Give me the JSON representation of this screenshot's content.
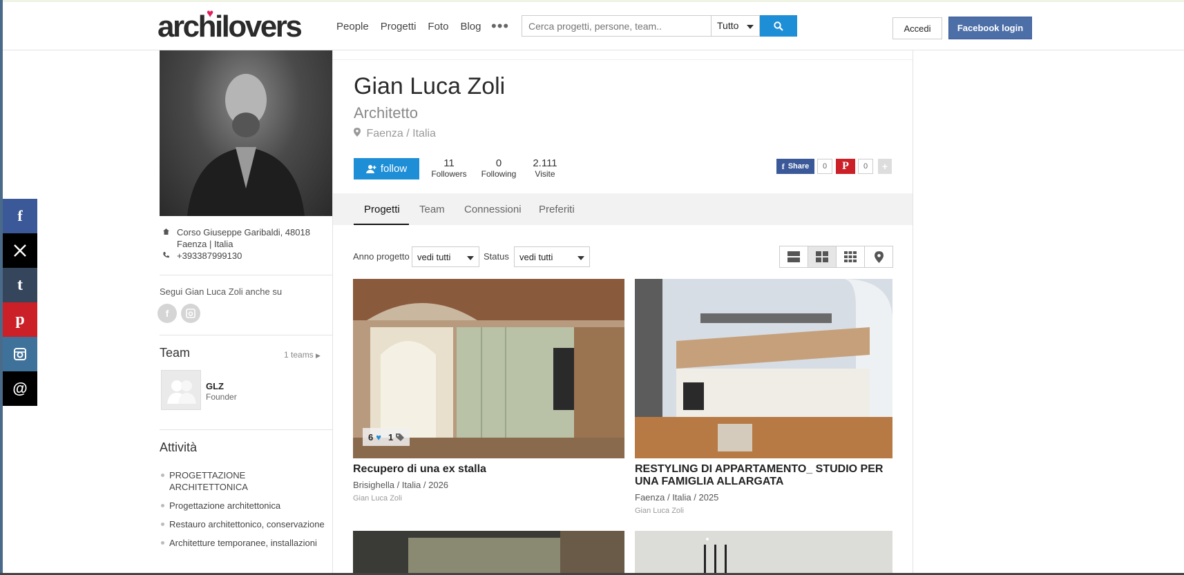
{
  "header": {
    "logo": "archilovers",
    "nav": [
      "People",
      "Progetti",
      "Foto",
      "Blog"
    ],
    "search_placeholder": "Cerca progetti, persone, team..",
    "search_scope": "Tutto",
    "login_label": "Accedi",
    "facebook_login_label": "Facebook login"
  },
  "social_share": [
    {
      "icon": "facebook-icon",
      "color": "#3b5998"
    },
    {
      "icon": "x-icon",
      "color": "#000000"
    },
    {
      "icon": "tumblr-icon",
      "color": "#35465c"
    },
    {
      "icon": "pinterest-icon",
      "color": "#cb2027"
    },
    {
      "icon": "instagram-icon",
      "color": "#3f729b"
    },
    {
      "icon": "threads-icon",
      "color": "#000000"
    }
  ],
  "profile": {
    "name": "Gian Luca Zoli",
    "profession": "Architetto",
    "location": "Faenza / Italia",
    "follow_label": "follow",
    "stats": [
      {
        "num": "11",
        "label": "Followers"
      },
      {
        "num": "0",
        "label": "Following"
      },
      {
        "num": "2.111",
        "label": "Visite"
      }
    ],
    "share_label": "Share",
    "fb_count": "0",
    "pin_count": "0"
  },
  "sidebar": {
    "address_line1": "Corso Giuseppe Garibaldi, 48018",
    "address_line2": "Faenza | Italia",
    "phone": "+393387999130",
    "follow_also": "Segui Gian Luca Zoli anche su",
    "team_title": "Team",
    "team_count": "1 teams",
    "team_member_name": "GLZ",
    "team_member_role": "Founder",
    "activities_title": "Attività",
    "activities": [
      "PROGETTAZIONE ARCHITETTONICA",
      "Progettazione architettonica",
      "Restauro architettonico, conservazione",
      "Architetture temporanee, installazioni"
    ]
  },
  "tabs": [
    "Progetti",
    "Team",
    "Connessioni",
    "Preferiti"
  ],
  "filters": {
    "anno_label": "Anno progetto",
    "anno_value": "vedi tutti",
    "status_label": "Status",
    "status_value": "vedi tutti"
  },
  "projects": [
    {
      "title": "Recupero di una ex stalla",
      "meta": "Brisighella / Italia / 2026",
      "author": "Gian Luca Zoli",
      "likes": "6",
      "tags": "1"
    },
    {
      "title": "RESTYLING DI APPARTAMENTO_ STUDIO PER UNA FAMIGLIA ALLARGATA",
      "meta": "Faenza / Italia / 2025",
      "author": "Gian Luca Zoli"
    }
  ],
  "colors": {
    "accent": "#1e8ed6",
    "facebook": "#3b5998",
    "pinterest": "#cb2027",
    "heart": "#e01f5b"
  }
}
